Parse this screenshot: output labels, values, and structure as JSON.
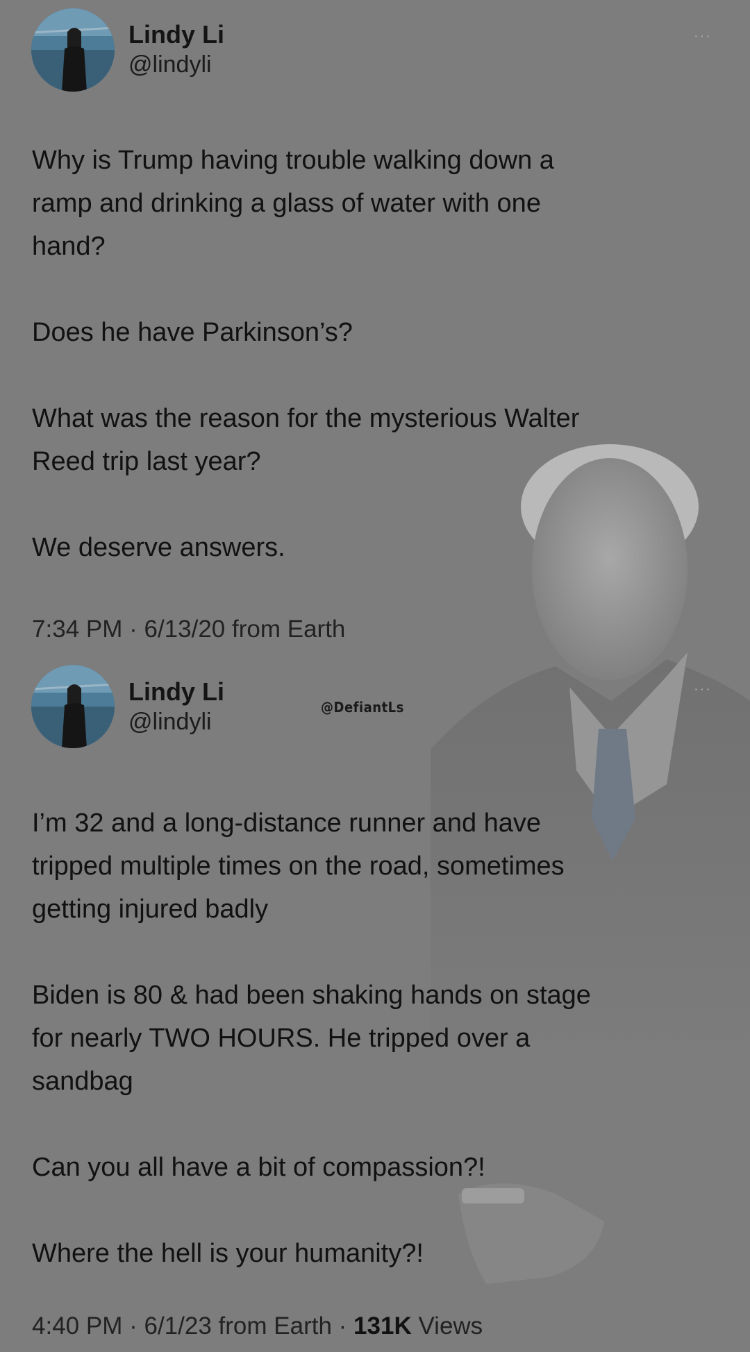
{
  "tweets": [
    {
      "display_name": "Lindy Li",
      "handle": "@lindyli",
      "more_icon": "more-dots-icon",
      "paragraphs": [
        "Why is Trump having trouble walking down a\nramp and drinking a glass of water with one\nhand?",
        "Does he have Parkinson’s?",
        "What was the reason for the mysterious Walter\nReed trip last year?",
        "We deserve answers."
      ],
      "time": "7:34 PM",
      "date": "6/13/20",
      "source": "from Earth"
    },
    {
      "display_name": "Lindy Li",
      "handle": "@lindyli",
      "more_icon": "more-dots-icon",
      "paragraphs": [
        "I’m 32 and a long-distance runner and have\ntripped multiple times on the road, sometimes\ngetting injured badly",
        "Biden is 80 & had been shaking hands on stage\nfor nearly TWO HOURS. He tripped over a\nsandbag",
        "Can you all have a bit of compassion?!",
        "Where the hell is your humanity?!"
      ],
      "time": "4:40 PM",
      "date": "6/1/23",
      "source": "from Earth",
      "views_count": "131K",
      "views_label": "Views"
    }
  ],
  "watermark": "@DefiantLs",
  "separator": "·",
  "more_glyph": "···",
  "colors": {
    "background": "#7d7d7d",
    "text": "#111111"
  }
}
